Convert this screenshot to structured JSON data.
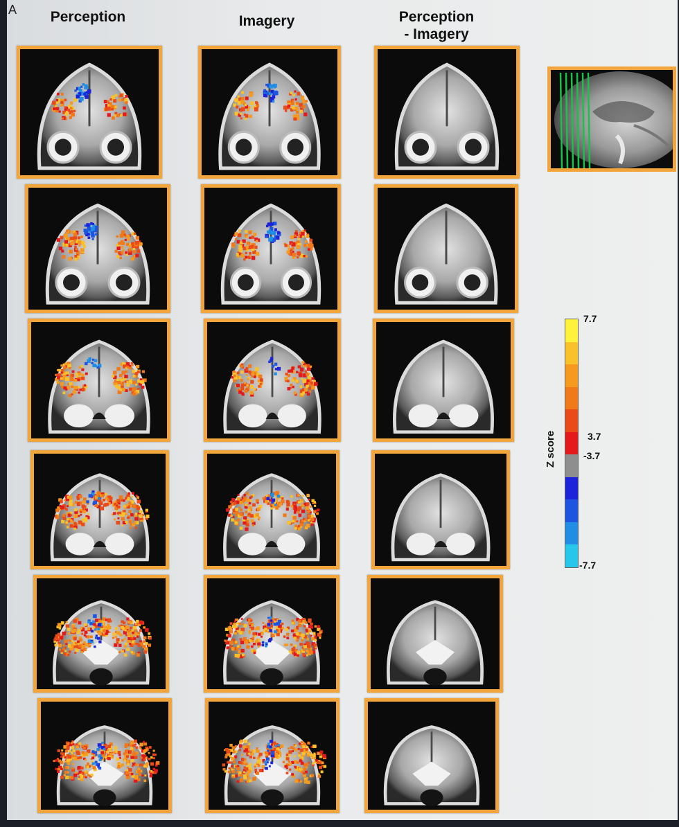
{
  "panel_label": "A",
  "columns": [
    {
      "title_lines": [
        "Perception"
      ]
    },
    {
      "title_lines": [
        "Imagery"
      ]
    },
    {
      "title_lines": [
        "Perception",
        "- Imagery"
      ]
    }
  ],
  "colorbar": {
    "title": "Z score",
    "max_label": "7.7",
    "pos_threshold_label": "3.7",
    "neg_threshold_label": "-3.7",
    "min_label": "-7.7",
    "colors": [
      "#fff23a",
      "#f9c12a",
      "#f59a1f",
      "#f07a1a",
      "#ea4a18",
      "#e3191c",
      "#8e8e8e",
      "#1c23d8",
      "#1d55e0",
      "#1f8ee4",
      "#27c7ec"
    ]
  },
  "slices": 6,
  "colors": {
    "frame": "#f1a53b",
    "activation_hot": "#f0701c",
    "activation_cold": "#1c3fe0",
    "locator_lines": "#19c24a"
  }
}
